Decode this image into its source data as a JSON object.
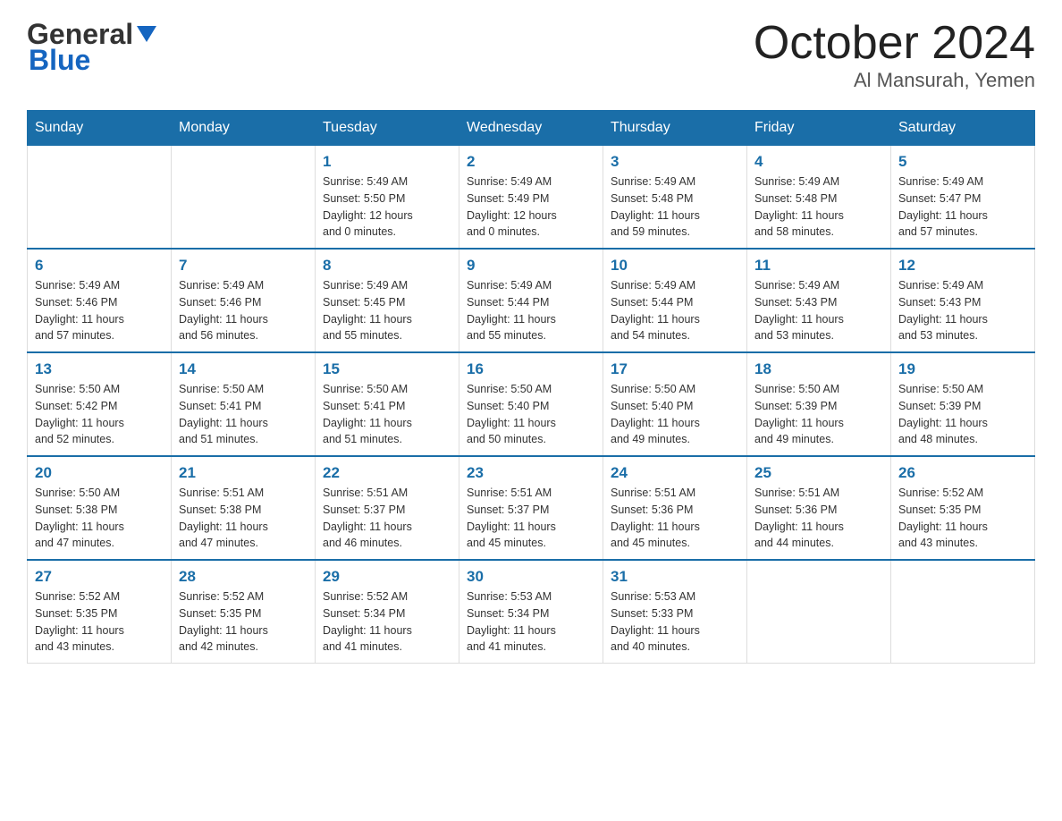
{
  "header": {
    "logo_general": "General",
    "logo_blue": "Blue",
    "main_title": "October 2024",
    "subtitle": "Al Mansurah, Yemen"
  },
  "days_of_week": [
    "Sunday",
    "Monday",
    "Tuesday",
    "Wednesday",
    "Thursday",
    "Friday",
    "Saturday"
  ],
  "weeks": [
    [
      {
        "day": "",
        "info": ""
      },
      {
        "day": "",
        "info": ""
      },
      {
        "day": "1",
        "info": "Sunrise: 5:49 AM\nSunset: 5:50 PM\nDaylight: 12 hours\nand 0 minutes."
      },
      {
        "day": "2",
        "info": "Sunrise: 5:49 AM\nSunset: 5:49 PM\nDaylight: 12 hours\nand 0 minutes."
      },
      {
        "day": "3",
        "info": "Sunrise: 5:49 AM\nSunset: 5:48 PM\nDaylight: 11 hours\nand 59 minutes."
      },
      {
        "day": "4",
        "info": "Sunrise: 5:49 AM\nSunset: 5:48 PM\nDaylight: 11 hours\nand 58 minutes."
      },
      {
        "day": "5",
        "info": "Sunrise: 5:49 AM\nSunset: 5:47 PM\nDaylight: 11 hours\nand 57 minutes."
      }
    ],
    [
      {
        "day": "6",
        "info": "Sunrise: 5:49 AM\nSunset: 5:46 PM\nDaylight: 11 hours\nand 57 minutes."
      },
      {
        "day": "7",
        "info": "Sunrise: 5:49 AM\nSunset: 5:46 PM\nDaylight: 11 hours\nand 56 minutes."
      },
      {
        "day": "8",
        "info": "Sunrise: 5:49 AM\nSunset: 5:45 PM\nDaylight: 11 hours\nand 55 minutes."
      },
      {
        "day": "9",
        "info": "Sunrise: 5:49 AM\nSunset: 5:44 PM\nDaylight: 11 hours\nand 55 minutes."
      },
      {
        "day": "10",
        "info": "Sunrise: 5:49 AM\nSunset: 5:44 PM\nDaylight: 11 hours\nand 54 minutes."
      },
      {
        "day": "11",
        "info": "Sunrise: 5:49 AM\nSunset: 5:43 PM\nDaylight: 11 hours\nand 53 minutes."
      },
      {
        "day": "12",
        "info": "Sunrise: 5:49 AM\nSunset: 5:43 PM\nDaylight: 11 hours\nand 53 minutes."
      }
    ],
    [
      {
        "day": "13",
        "info": "Sunrise: 5:50 AM\nSunset: 5:42 PM\nDaylight: 11 hours\nand 52 minutes."
      },
      {
        "day": "14",
        "info": "Sunrise: 5:50 AM\nSunset: 5:41 PM\nDaylight: 11 hours\nand 51 minutes."
      },
      {
        "day": "15",
        "info": "Sunrise: 5:50 AM\nSunset: 5:41 PM\nDaylight: 11 hours\nand 51 minutes."
      },
      {
        "day": "16",
        "info": "Sunrise: 5:50 AM\nSunset: 5:40 PM\nDaylight: 11 hours\nand 50 minutes."
      },
      {
        "day": "17",
        "info": "Sunrise: 5:50 AM\nSunset: 5:40 PM\nDaylight: 11 hours\nand 49 minutes."
      },
      {
        "day": "18",
        "info": "Sunrise: 5:50 AM\nSunset: 5:39 PM\nDaylight: 11 hours\nand 49 minutes."
      },
      {
        "day": "19",
        "info": "Sunrise: 5:50 AM\nSunset: 5:39 PM\nDaylight: 11 hours\nand 48 minutes."
      }
    ],
    [
      {
        "day": "20",
        "info": "Sunrise: 5:50 AM\nSunset: 5:38 PM\nDaylight: 11 hours\nand 47 minutes."
      },
      {
        "day": "21",
        "info": "Sunrise: 5:51 AM\nSunset: 5:38 PM\nDaylight: 11 hours\nand 47 minutes."
      },
      {
        "day": "22",
        "info": "Sunrise: 5:51 AM\nSunset: 5:37 PM\nDaylight: 11 hours\nand 46 minutes."
      },
      {
        "day": "23",
        "info": "Sunrise: 5:51 AM\nSunset: 5:37 PM\nDaylight: 11 hours\nand 45 minutes."
      },
      {
        "day": "24",
        "info": "Sunrise: 5:51 AM\nSunset: 5:36 PM\nDaylight: 11 hours\nand 45 minutes."
      },
      {
        "day": "25",
        "info": "Sunrise: 5:51 AM\nSunset: 5:36 PM\nDaylight: 11 hours\nand 44 minutes."
      },
      {
        "day": "26",
        "info": "Sunrise: 5:52 AM\nSunset: 5:35 PM\nDaylight: 11 hours\nand 43 minutes."
      }
    ],
    [
      {
        "day": "27",
        "info": "Sunrise: 5:52 AM\nSunset: 5:35 PM\nDaylight: 11 hours\nand 43 minutes."
      },
      {
        "day": "28",
        "info": "Sunrise: 5:52 AM\nSunset: 5:35 PM\nDaylight: 11 hours\nand 42 minutes."
      },
      {
        "day": "29",
        "info": "Sunrise: 5:52 AM\nSunset: 5:34 PM\nDaylight: 11 hours\nand 41 minutes."
      },
      {
        "day": "30",
        "info": "Sunrise: 5:53 AM\nSunset: 5:34 PM\nDaylight: 11 hours\nand 41 minutes."
      },
      {
        "day": "31",
        "info": "Sunrise: 5:53 AM\nSunset: 5:33 PM\nDaylight: 11 hours\nand 40 minutes."
      },
      {
        "day": "",
        "info": ""
      },
      {
        "day": "",
        "info": ""
      }
    ]
  ]
}
